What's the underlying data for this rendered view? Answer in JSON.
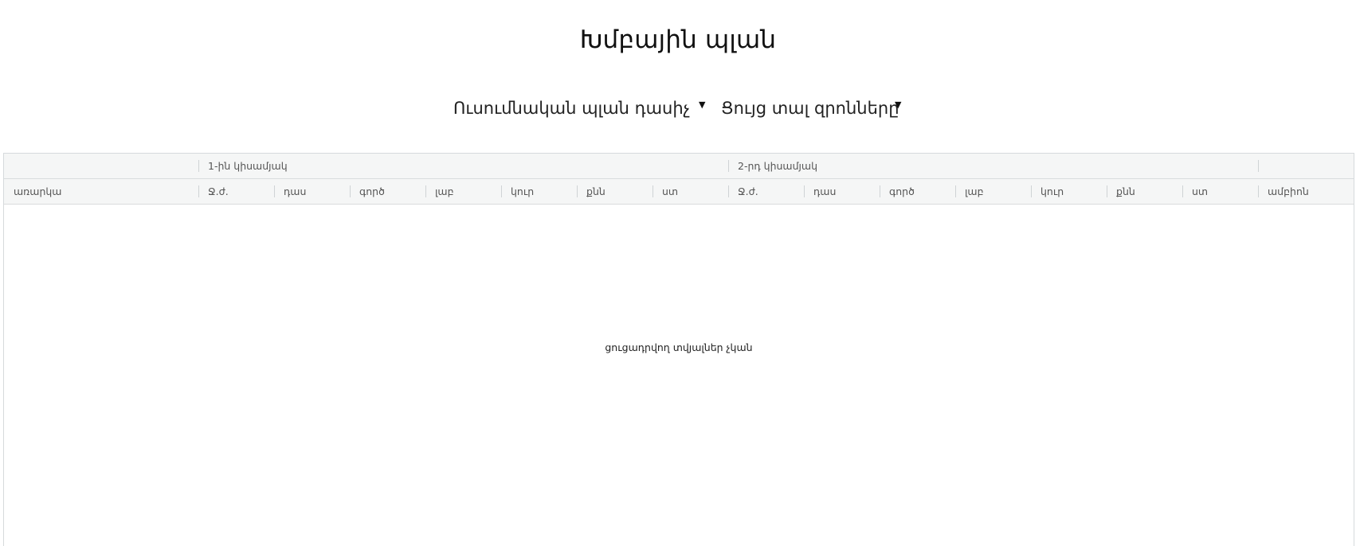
{
  "page": {
    "title": "Խմբային պլան"
  },
  "filters": {
    "curriculum_label": "Ուսումնական պլան դասիչ",
    "credits_label": "Ցույց տալ զրոնները",
    "caret_icon": "▼"
  },
  "grid": {
    "group_headers": {
      "semester1": "1-ին կիսամյակ",
      "semester2": "2-րդ կիսամյակ"
    },
    "columns": {
      "subject": "առարկա",
      "s1_credits": "Ջ.ժ.",
      "s1_lesson": "դաս",
      "s1_practice": "գործ",
      "s1_lab": "լաբ",
      "s1_course": "կուր",
      "s1_exam": "քնն",
      "s1_test": "ստ",
      "s2_credits": "Ջ.ժ.",
      "s2_lesson": "դաս",
      "s2_practice": "գործ",
      "s2_lab": "լաբ",
      "s2_course": "կուր",
      "s2_exam": "քնն",
      "s2_test": "ստ",
      "total": "ամբիոն"
    },
    "empty_message": "ցուցադրվող տվյալներ չկան"
  }
}
